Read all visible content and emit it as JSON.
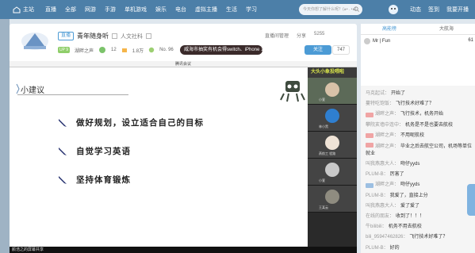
{
  "nav": {
    "home": "主站",
    "items": [
      "直播",
      "全部",
      "网游",
      "手游",
      "单机游戏",
      "娱乐",
      "电台",
      "虚拟主播",
      "生活",
      "学习"
    ],
    "search_placeholder": "今天你想了解什么呢？(๑• . •๑)",
    "right": [
      "动态",
      "签到",
      "我要开播"
    ]
  },
  "room": {
    "live_tag": "直播",
    "title": "青年随身听",
    "category": "人文社科",
    "level": "UP 9",
    "streamer": "湖畔之声",
    "fans_level": "12",
    "popularity": "1.8万",
    "rank": "No. 96",
    "banner": "威海市抽奖有机会得switch、iPhone 12",
    "top_actions": [
      "直播间管理",
      "分享",
      "5255"
    ],
    "follow": "关注",
    "follow_count": "747"
  },
  "player": {
    "meeting_title": "腾讯会议",
    "slide_heading": "小建议",
    "bullets": [
      "做好规划，设立适合自己的目标",
      "自觉学习英语",
      "坚持体育锻炼"
    ],
    "video_header": "大头小象投喂啦",
    "tiles": [
      "小萱",
      "林小黑",
      "燕航工 程路",
      "小萱",
      "王某云"
    ],
    "share_label": "颜浩之的屏幕共享"
  },
  "chat": {
    "tabs": [
      "高能榜",
      "大航海"
    ],
    "rank_user": "Mr | Fun",
    "rank_num": "61",
    "messages": [
      {
        "user": "马克起试：",
        "text": "开始了",
        "badge": ""
      },
      {
        "user": "蔓特吃饱饭：",
        "text": "飞行技术好难了？",
        "badge": ""
      },
      {
        "user": "湖畔之声：",
        "text": "飞行技术，机务开始",
        "badge": "red"
      },
      {
        "user": "攀院亥墙中连中：",
        "text": "机务是不是也要去航校",
        "badge": ""
      },
      {
        "user": "湖畔之声：",
        "text": "不用呢航校",
        "badge": "red"
      },
      {
        "user": "湖畔之声：",
        "text": "毕业之后去航空公司，机场等单位就业",
        "badge": "red"
      },
      {
        "user": "叫我燕惠大人：",
        "text": "吻仔yyds",
        "badge": ""
      },
      {
        "user": "PLUM-B：",
        "text": "厉害了",
        "badge": ""
      },
      {
        "user": "湖畔之声：",
        "text": "吻仔yyds",
        "badge": "blue"
      },
      {
        "user": "PLUM-B：",
        "text": "我爱了，直接上分",
        "badge": ""
      },
      {
        "user": "叫我燕惠大人：",
        "text": "爱了爱了",
        "badge": ""
      },
      {
        "user": "在线的朋友：",
        "text": "收到了！！！",
        "badge": ""
      },
      {
        "user": "牛bilibili：",
        "text": "机务不用去航校",
        "badge": ""
      },
      {
        "user": "bili_95947462826：",
        "text": "飞行技术好难了？",
        "badge": ""
      },
      {
        "user": "PLUM-B：",
        "text": "好的",
        "badge": ""
      }
    ]
  }
}
